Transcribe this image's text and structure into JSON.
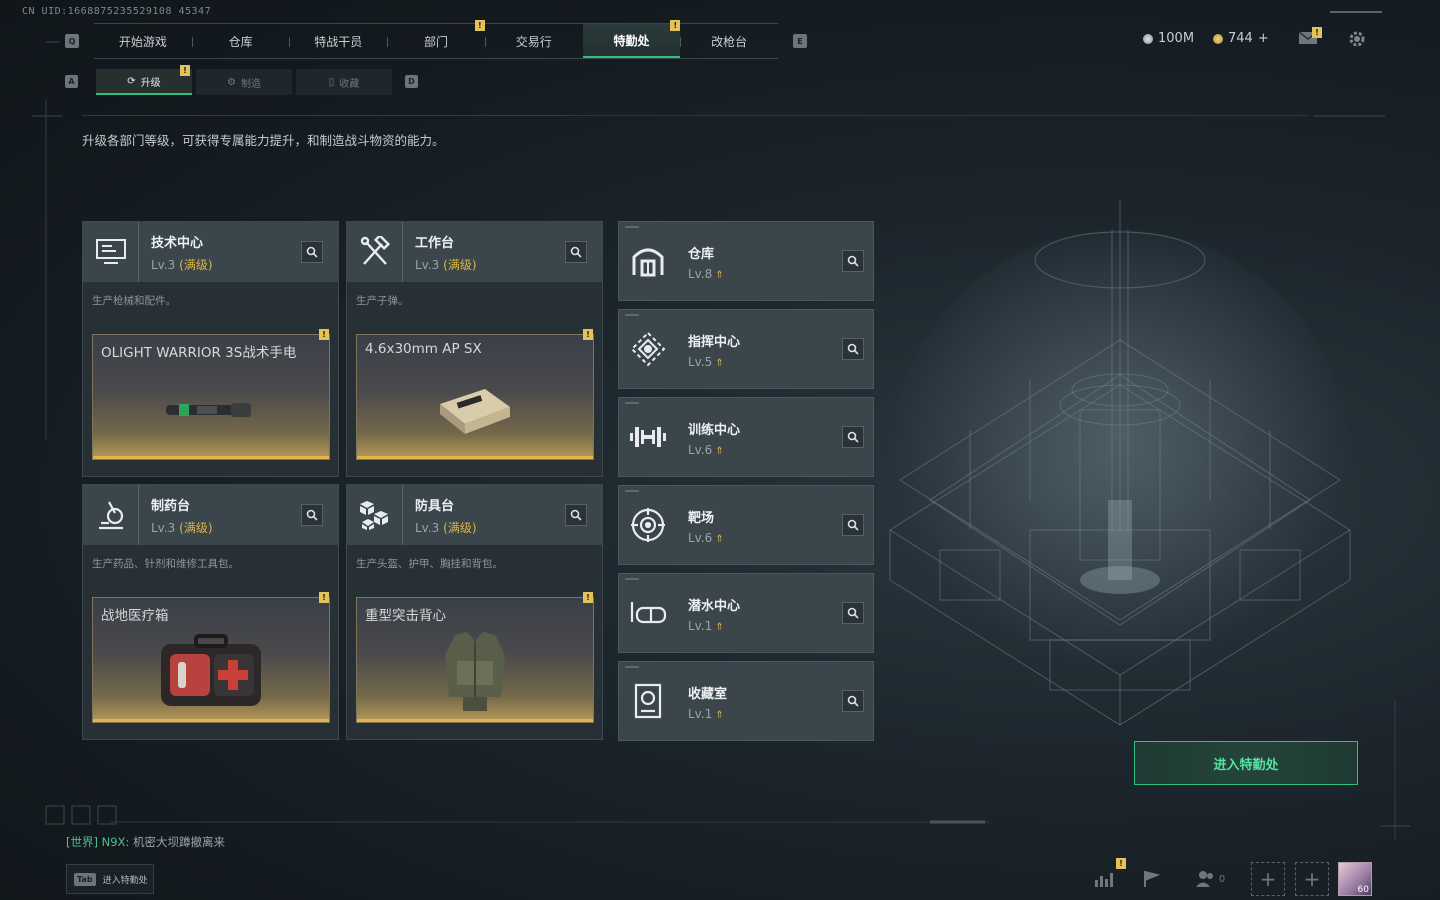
{
  "uid": "CN UID:1668875235529108 45347",
  "top_nav": {
    "left_key": "Q",
    "right_key": "E",
    "tabs": [
      {
        "label": "开始游戏"
      },
      {
        "label": "仓库"
      },
      {
        "label": "特战干员"
      },
      {
        "label": "部门"
      },
      {
        "label": "交易行"
      },
      {
        "label": "特勤处",
        "active": true
      },
      {
        "label": "改枪台"
      }
    ]
  },
  "sub_nav": {
    "left_key": "A",
    "right_key": "D",
    "tabs": [
      {
        "label": "升级",
        "active": true
      },
      {
        "label": "制造"
      },
      {
        "label": "收藏"
      }
    ]
  },
  "currency": {
    "silver": "100M",
    "gold": "744",
    "gold_add": "+"
  },
  "badge_mark": "!",
  "description": "升级各部门等级，可获得专属能力提升，和制造战斗物资的能力。",
  "big_cards": [
    {
      "icon": "computer-icon",
      "title": "技术中心",
      "level": "Lv.3",
      "max": "(满级)",
      "desc": "生产枪械和配件。",
      "product": "OLIGHT WARRIOR 3S战术手电"
    },
    {
      "icon": "hammer-wrench-icon",
      "title": "工作台",
      "level": "Lv.3",
      "max": "(满级)",
      "desc": "生产子弹。",
      "product": "4.6x30mm AP SX"
    },
    {
      "icon": "microscope-icon",
      "title": "制药台",
      "level": "Lv.3",
      "max": "(满级)",
      "desc": "生产药品、针剂和维修工具包。",
      "product": "战地医疗箱"
    },
    {
      "icon": "cubes-icon",
      "title": "防具台",
      "level": "Lv.3",
      "max": "(满级)",
      "desc": "生产头盔、护甲、胸挂和背包。",
      "product": "重型突击背心"
    }
  ],
  "small_cards": [
    {
      "icon": "warehouse-icon",
      "title": "仓库",
      "level": "Lv.8"
    },
    {
      "icon": "command-icon",
      "title": "指挥中心",
      "level": "Lv.5"
    },
    {
      "icon": "dumbbell-icon",
      "title": "训练中心",
      "level": "Lv.6"
    },
    {
      "icon": "target-icon",
      "title": "靶场",
      "level": "Lv.6"
    },
    {
      "icon": "diving-mask-icon",
      "title": "潜水中心",
      "level": "Lv.1"
    },
    {
      "icon": "collection-icon",
      "title": "收藏室",
      "level": "Lv.1"
    }
  ],
  "enter_button": "进入特勤处",
  "chat": {
    "channel": "[世界]",
    "user": "N9X:",
    "message": "机密大坝蹲撤离来"
  },
  "tab_hint": {
    "key": "Tab",
    "label": "进入特勤处"
  },
  "bottom": {
    "friends_count": "0",
    "avatar_level": "60"
  },
  "colors": {
    "accent_green": "#2fbf83",
    "gold": "#d8b44a",
    "badge": "#e3c25a"
  }
}
